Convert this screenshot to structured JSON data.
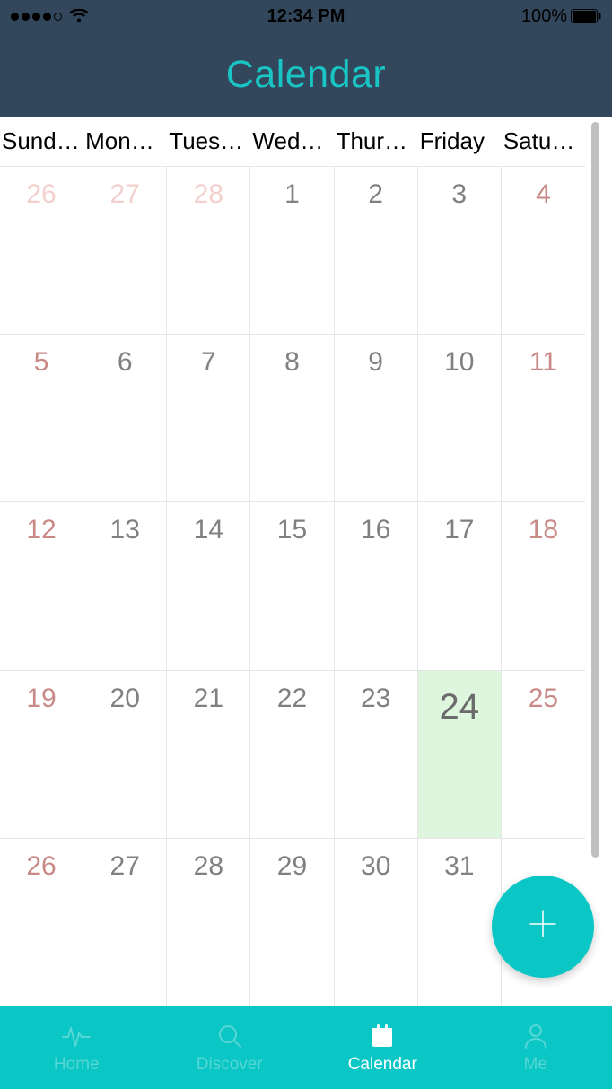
{
  "status": {
    "time": "12:34 PM",
    "battery_pct": "100%"
  },
  "title": "Calendar",
  "day_headers": [
    "Sund…",
    "Mon…",
    "Tues…",
    "Wed…",
    "Thur…",
    "Friday",
    "Satu…"
  ],
  "weeks": [
    [
      {
        "n": "26",
        "cls": "other-month"
      },
      {
        "n": "27",
        "cls": "other-month"
      },
      {
        "n": "28",
        "cls": "other-month"
      },
      {
        "n": "1",
        "cls": ""
      },
      {
        "n": "2",
        "cls": ""
      },
      {
        "n": "3",
        "cls": ""
      },
      {
        "n": "4",
        "cls": "weekend"
      }
    ],
    [
      {
        "n": "5",
        "cls": "weekend"
      },
      {
        "n": "6",
        "cls": ""
      },
      {
        "n": "7",
        "cls": ""
      },
      {
        "n": "8",
        "cls": ""
      },
      {
        "n": "9",
        "cls": ""
      },
      {
        "n": "10",
        "cls": ""
      },
      {
        "n": "11",
        "cls": "weekend"
      }
    ],
    [
      {
        "n": "12",
        "cls": "weekend"
      },
      {
        "n": "13",
        "cls": ""
      },
      {
        "n": "14",
        "cls": ""
      },
      {
        "n": "15",
        "cls": ""
      },
      {
        "n": "16",
        "cls": ""
      },
      {
        "n": "17",
        "cls": ""
      },
      {
        "n": "18",
        "cls": "weekend"
      }
    ],
    [
      {
        "n": "19",
        "cls": "weekend"
      },
      {
        "n": "20",
        "cls": ""
      },
      {
        "n": "21",
        "cls": ""
      },
      {
        "n": "22",
        "cls": ""
      },
      {
        "n": "23",
        "cls": ""
      },
      {
        "n": "24",
        "cls": "today"
      },
      {
        "n": "25",
        "cls": "weekend"
      }
    ],
    [
      {
        "n": "26",
        "cls": "weekend"
      },
      {
        "n": "27",
        "cls": ""
      },
      {
        "n": "28",
        "cls": ""
      },
      {
        "n": "29",
        "cls": ""
      },
      {
        "n": "30",
        "cls": ""
      },
      {
        "n": "31",
        "cls": ""
      },
      {
        "n": "",
        "cls": ""
      }
    ]
  ],
  "fab": {
    "label": "+"
  },
  "tabs": [
    {
      "label": "Home",
      "icon": "activity-icon",
      "active": false
    },
    {
      "label": "Discover",
      "icon": "search-icon",
      "active": false
    },
    {
      "label": "Calendar",
      "icon": "calendar-icon",
      "active": true
    },
    {
      "label": "Me",
      "icon": "person-icon",
      "active": false
    }
  ]
}
